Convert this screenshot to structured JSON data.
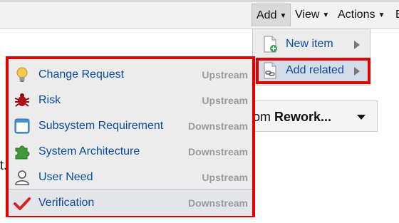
{
  "toolbar": {
    "add_label": "Add",
    "view_label": "View",
    "actions_label": "Actions",
    "more_label": "E"
  },
  "add_submenu": {
    "items": [
      {
        "label": "New item",
        "icon": "new-item-icon"
      },
      {
        "label": "Add related",
        "icon": "add-related-icon"
      }
    ]
  },
  "background": {
    "rework_prefix": "om ",
    "rework_bold": "Rework...",
    "page_text": "t."
  },
  "related_menu": {
    "items": [
      {
        "label": "Change Request",
        "direction": "Upstream",
        "icon": "lightbulb-icon"
      },
      {
        "label": "Risk",
        "direction": "Upstream",
        "icon": "bug-icon"
      },
      {
        "label": "Subsystem Requirement",
        "direction": "Downstream",
        "icon": "window-icon"
      },
      {
        "label": "System Architecture",
        "direction": "Downstream",
        "icon": "puzzle-icon"
      },
      {
        "label": "User Need",
        "direction": "Upstream",
        "icon": "user-icon"
      },
      {
        "label": "Verification",
        "direction": "Downstream",
        "icon": "checkmark-icon"
      }
    ]
  },
  "colors": {
    "highlight": "#e00000",
    "link": "#0b4a9c",
    "direction_text": "#9a9a9a"
  }
}
